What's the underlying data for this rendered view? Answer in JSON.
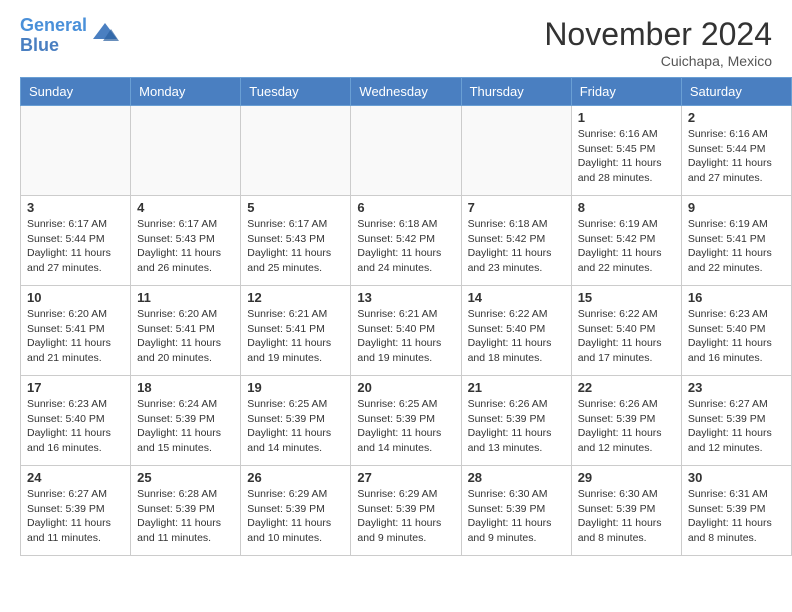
{
  "header": {
    "logo_line1": "General",
    "logo_line2": "Blue",
    "month": "November 2024",
    "location": "Cuichapa, Mexico"
  },
  "weekdays": [
    "Sunday",
    "Monday",
    "Tuesday",
    "Wednesday",
    "Thursday",
    "Friday",
    "Saturday"
  ],
  "weeks": [
    [
      {
        "day": "",
        "info": ""
      },
      {
        "day": "",
        "info": ""
      },
      {
        "day": "",
        "info": ""
      },
      {
        "day": "",
        "info": ""
      },
      {
        "day": "",
        "info": ""
      },
      {
        "day": "1",
        "info": "Sunrise: 6:16 AM\nSunset: 5:45 PM\nDaylight: 11 hours and 28 minutes."
      },
      {
        "day": "2",
        "info": "Sunrise: 6:16 AM\nSunset: 5:44 PM\nDaylight: 11 hours and 27 minutes."
      }
    ],
    [
      {
        "day": "3",
        "info": "Sunrise: 6:17 AM\nSunset: 5:44 PM\nDaylight: 11 hours and 27 minutes."
      },
      {
        "day": "4",
        "info": "Sunrise: 6:17 AM\nSunset: 5:43 PM\nDaylight: 11 hours and 26 minutes."
      },
      {
        "day": "5",
        "info": "Sunrise: 6:17 AM\nSunset: 5:43 PM\nDaylight: 11 hours and 25 minutes."
      },
      {
        "day": "6",
        "info": "Sunrise: 6:18 AM\nSunset: 5:42 PM\nDaylight: 11 hours and 24 minutes."
      },
      {
        "day": "7",
        "info": "Sunrise: 6:18 AM\nSunset: 5:42 PM\nDaylight: 11 hours and 23 minutes."
      },
      {
        "day": "8",
        "info": "Sunrise: 6:19 AM\nSunset: 5:42 PM\nDaylight: 11 hours and 22 minutes."
      },
      {
        "day": "9",
        "info": "Sunrise: 6:19 AM\nSunset: 5:41 PM\nDaylight: 11 hours and 22 minutes."
      }
    ],
    [
      {
        "day": "10",
        "info": "Sunrise: 6:20 AM\nSunset: 5:41 PM\nDaylight: 11 hours and 21 minutes."
      },
      {
        "day": "11",
        "info": "Sunrise: 6:20 AM\nSunset: 5:41 PM\nDaylight: 11 hours and 20 minutes."
      },
      {
        "day": "12",
        "info": "Sunrise: 6:21 AM\nSunset: 5:41 PM\nDaylight: 11 hours and 19 minutes."
      },
      {
        "day": "13",
        "info": "Sunrise: 6:21 AM\nSunset: 5:40 PM\nDaylight: 11 hours and 19 minutes."
      },
      {
        "day": "14",
        "info": "Sunrise: 6:22 AM\nSunset: 5:40 PM\nDaylight: 11 hours and 18 minutes."
      },
      {
        "day": "15",
        "info": "Sunrise: 6:22 AM\nSunset: 5:40 PM\nDaylight: 11 hours and 17 minutes."
      },
      {
        "day": "16",
        "info": "Sunrise: 6:23 AM\nSunset: 5:40 PM\nDaylight: 11 hours and 16 minutes."
      }
    ],
    [
      {
        "day": "17",
        "info": "Sunrise: 6:23 AM\nSunset: 5:40 PM\nDaylight: 11 hours and 16 minutes."
      },
      {
        "day": "18",
        "info": "Sunrise: 6:24 AM\nSunset: 5:39 PM\nDaylight: 11 hours and 15 minutes."
      },
      {
        "day": "19",
        "info": "Sunrise: 6:25 AM\nSunset: 5:39 PM\nDaylight: 11 hours and 14 minutes."
      },
      {
        "day": "20",
        "info": "Sunrise: 6:25 AM\nSunset: 5:39 PM\nDaylight: 11 hours and 14 minutes."
      },
      {
        "day": "21",
        "info": "Sunrise: 6:26 AM\nSunset: 5:39 PM\nDaylight: 11 hours and 13 minutes."
      },
      {
        "day": "22",
        "info": "Sunrise: 6:26 AM\nSunset: 5:39 PM\nDaylight: 11 hours and 12 minutes."
      },
      {
        "day": "23",
        "info": "Sunrise: 6:27 AM\nSunset: 5:39 PM\nDaylight: 11 hours and 12 minutes."
      }
    ],
    [
      {
        "day": "24",
        "info": "Sunrise: 6:27 AM\nSunset: 5:39 PM\nDaylight: 11 hours and 11 minutes."
      },
      {
        "day": "25",
        "info": "Sunrise: 6:28 AM\nSunset: 5:39 PM\nDaylight: 11 hours and 11 minutes."
      },
      {
        "day": "26",
        "info": "Sunrise: 6:29 AM\nSunset: 5:39 PM\nDaylight: 11 hours and 10 minutes."
      },
      {
        "day": "27",
        "info": "Sunrise: 6:29 AM\nSunset: 5:39 PM\nDaylight: 11 hours and 9 minutes."
      },
      {
        "day": "28",
        "info": "Sunrise: 6:30 AM\nSunset: 5:39 PM\nDaylight: 11 hours and 9 minutes."
      },
      {
        "day": "29",
        "info": "Sunrise: 6:30 AM\nSunset: 5:39 PM\nDaylight: 11 hours and 8 minutes."
      },
      {
        "day": "30",
        "info": "Sunrise: 6:31 AM\nSunset: 5:39 PM\nDaylight: 11 hours and 8 minutes."
      }
    ]
  ]
}
